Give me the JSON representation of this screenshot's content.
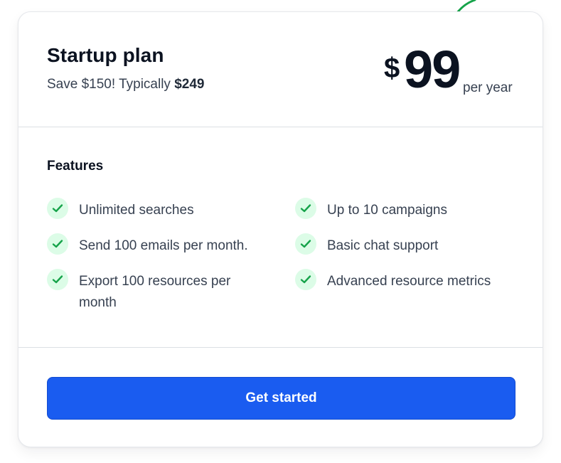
{
  "plan": {
    "title": "Startup plan",
    "save_text": "Save $150! Typically",
    "typical_price": "$249",
    "currency": "$",
    "price": "99",
    "period": "per year"
  },
  "features": {
    "heading": "Features",
    "items": [
      {
        "label": "Unlimited searches",
        "icon": "check-icon"
      },
      {
        "label": "Up to 10 campaigns",
        "icon": "check-icon"
      },
      {
        "label": "Send 100 emails per month.",
        "icon": "check-icon"
      },
      {
        "label": "Basic chat support",
        "icon": "check-icon"
      },
      {
        "label": "Export 100 resources per month",
        "icon": "check-icon"
      },
      {
        "label": "Advanced resource metrics",
        "icon": "check-icon"
      }
    ]
  },
  "cta": {
    "label": "Get started"
  },
  "colors": {
    "accent": "#1a5cf0",
    "check_bg": "#dcfce7",
    "check_fg": "#16a34a",
    "arrow": "#16a34a"
  }
}
